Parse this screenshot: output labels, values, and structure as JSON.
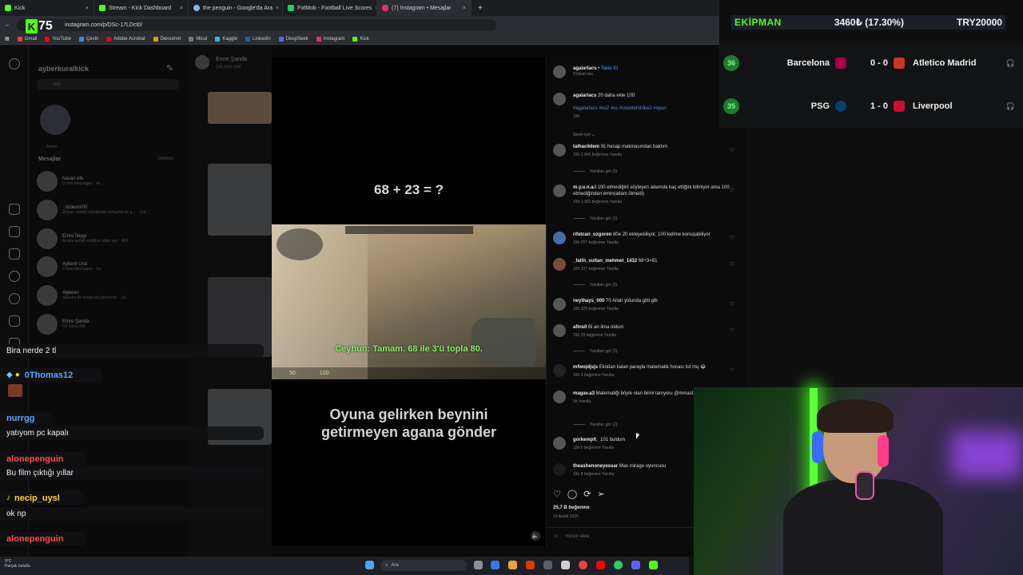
{
  "browser": {
    "tabs": [
      {
        "label": "Kick",
        "color": "#53fc18"
      },
      {
        "label": "Stream - Kick Dashboard",
        "color": "#53fc18"
      },
      {
        "label": "the penguin - Google'da Ara",
        "color": "#8ab4f8"
      },
      {
        "label": "FotMob - Football Live Scores",
        "color": "#1dd15c"
      },
      {
        "label": "(7) Instagram • Mesajlar",
        "color": "#e1306c"
      }
    ],
    "url": "instagram.com/p/DSc-17LDct0/",
    "bookmarks": [
      "Gmail",
      "YouTube",
      "Çeviri",
      "Adobe Acrobat",
      "Densonet",
      "Micul",
      "Kaggle",
      "LinkedIn",
      "DeepSeek",
      "Instagram",
      "Kick"
    ],
    "kick_badge_number": "75"
  },
  "instagram": {
    "username": "ayberkuralkick",
    "search_placeholder": "Ara",
    "section_messages": "Mesajlar",
    "section_requests": "İstekler",
    "note_label": "Notun",
    "dms": [
      {
        "name": "hasan efe",
        "sub": "3 new messages · 4d"
      },
      {
        "name": "_ozdemir00",
        "sub": "ambas sadaki sokağında öyleymiş bir g... · 13d"
      },
      {
        "name": "Emre İleygi",
        "sub": "Acaba sende eriştikle adan şey · 46d"
      },
      {
        "name": "Ayberk Ural",
        "sub": "3 new messages · 1w"
      },
      {
        "name": "Alperen",
        "sub": "Alperen bir sonya eki gönderdi. · 1w"
      },
      {
        "name": "Emre Şanda",
        "sub": "Ok bora attiii"
      }
    ],
    "chat_header": "Emre Şanda",
    "chat_sub": "Çok önce aktif",
    "reel": {
      "question": "68 + 23 = ?",
      "subtitle": "Ceyhun: Tamam. 68 ile 3'ü topla 80.",
      "hud_health": "50",
      "hud_armor": "100",
      "caption_line1": "Oyuna gelirken beynini",
      "caption_line2": "getirmeyen agana gönder"
    },
    "post": {
      "author": "agalarlacs",
      "follow": "Takip Et",
      "audio": "Orijinal ses",
      "caption": "20 daha ekle 100",
      "tags": "#agalarlacs #cs2 #cs #counterstrike2 #oyun",
      "caption_time": "15h",
      "sort_label": "Senin için",
      "likes": "25,7 B beğenme",
      "date": "19 Aralık 2025",
      "comment_placeholder": "Yorum ekle..."
    },
    "comments": [
      {
        "user": "talhacildem",
        "text": "91 hesap makinasından baktım",
        "meta": "15h   2.942 beğenme   Yanıtla",
        "replies": "Yanıtları gör (5)"
      },
      {
        "user": "m.y.u.n.a.l",
        "text": "100 etmediğini söyleyen adamda kaç ettiğini bilmiyor ama 100 etmediğinden emin(adam ölmedi)",
        "meta": "15h   1.360 beğenme   Yanıtla",
        "replies": "Yanıtları gör (1)"
      },
      {
        "user": "rifatcan_ozgoren",
        "text": "80e 20 ekleyebiliyor, 100 kelime konuşabiliyor",
        "meta": "15h   257 beğenme   Yanıtla",
        "replies": ""
      },
      {
        "user": "_fatih_sultan_mehmet_1432",
        "text": "68+3=81",
        "meta": "15h   107 beğenme   Yanıtla",
        "replies": "Yanıtları gör (5)"
      },
      {
        "user": "neythays_000",
        "text": "70 Allah yolunda gitti glb",
        "meta": "15h   329 beğenme   Yanıtla",
        "replies": ""
      },
      {
        "user": "aflns0",
        "text": "Bi an ikna oldum",
        "meta": "15h   25 beğenme   Yanıtla",
        "replies": "Yanıtları gör (2)"
      },
      {
        "user": "mfwojdjsjs",
        "text": "Ekodan kalan parayla matematik hocası tut mq 😂",
        "meta": "15h   3 beğenme   Yanıtla",
        "replies": ""
      },
      {
        "user": "magav.a3",
        "text": "Matematiği böyle olan birini tanıyoru @mmasl12",
        "meta": "5h   Yanıtla",
        "replies": "Yanıtları gör (2)"
      },
      {
        "user": "gorkemplt_",
        "text": "101 buldum",
        "meta": "15h   5 beğenme   Yanıtla",
        "replies": ""
      },
      {
        "user": "theashenoneyessar",
        "text": "Max mirage oyuncusu",
        "meta": "15h   8 beğenme   Yanıtla",
        "replies": ""
      }
    ]
  },
  "stream_chat": [
    {
      "type": "text",
      "text": "Bira nerde 2 tl"
    },
    {
      "type": "user",
      "text": "0Thomas12",
      "color": "blue"
    },
    {
      "type": "user",
      "text": "nurrgg",
      "color": "blue"
    },
    {
      "type": "text",
      "text": "yatıyom pc kapalı"
    },
    {
      "type": "user",
      "text": "alonepenguin",
      "color": "red"
    },
    {
      "type": "text",
      "text": "Bu film çıktığı yıllar"
    },
    {
      "type": "user",
      "text": "necip_uysl",
      "color": "yellow"
    },
    {
      "type": "text",
      "text": "ok np"
    },
    {
      "type": "user",
      "text": "alonepenguin",
      "color": "red"
    }
  ],
  "ticker": {
    "label": "EKİPMAN",
    "value": "3460₺ (17.30%)",
    "target": "TRY20000"
  },
  "matches": [
    {
      "minute": "36",
      "home": "Barcelona",
      "score": "0 - 0",
      "away": "Atletico Madrid",
      "home_color": "#a50044",
      "away_color": "#cb3524"
    },
    {
      "minute": "35",
      "home": "PSG",
      "score": "1 - 0",
      "away": "Liverpool",
      "home_color": "#004170",
      "away_color": "#c8102e"
    }
  ],
  "taskbar": {
    "weather_temp": "9°C",
    "weather_text": "Parçalı bulutlu",
    "search": "Ara"
  }
}
